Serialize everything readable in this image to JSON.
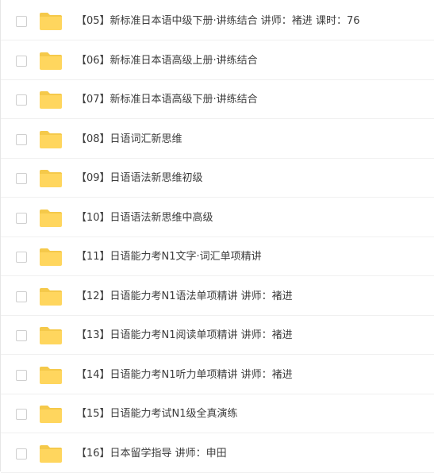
{
  "file_list": {
    "folder_icon_color": "#ffd65e",
    "folder_tab_color": "#f5c94a",
    "items": [
      {
        "label": "【05】新标准日本语中级下册·讲练结合 讲师：褚进 课时：76"
      },
      {
        "label": "【06】新标准日本语高级上册·讲练结合"
      },
      {
        "label": "【07】新标准日本语高级下册·讲练结合"
      },
      {
        "label": "【08】日语词汇新思维"
      },
      {
        "label": "【09】日语语法新思维初级"
      },
      {
        "label": "【10】日语语法新思维中高级"
      },
      {
        "label": "【11】日语能力考N1文字·词汇单项精讲"
      },
      {
        "label": "【12】日语能力考N1语法单项精讲 讲师：褚进"
      },
      {
        "label": "【13】日语能力考N1阅读单项精讲 讲师：褚进"
      },
      {
        "label": "【14】日语能力考N1听力单项精讲 讲师：褚进"
      },
      {
        "label": "【15】日语能力考试N1级全真演练"
      },
      {
        "label": "【16】日本留学指导 讲师：申田"
      }
    ]
  }
}
